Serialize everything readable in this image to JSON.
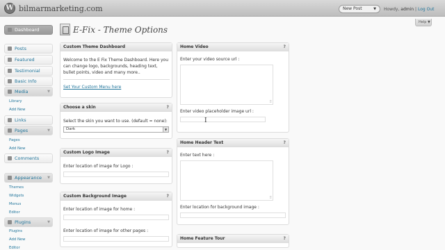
{
  "header": {
    "site_name": "bilmarmarketing.com",
    "new_post": "New Post",
    "howdy": "Howdy,",
    "user": "admin",
    "separator": "|",
    "logout": "Log Out",
    "help": "Help",
    "wp_logo_letter": "W"
  },
  "sidebar": {
    "dashboard": "Dashboard",
    "posts": "Posts",
    "featured": "Featured",
    "testimonial": "Testimonial",
    "basic_info": "Basic Info",
    "media": "Media",
    "media_library": "Library",
    "media_add_new": "Add New",
    "links": "Links",
    "pages": "Pages",
    "pages_pages": "Pages",
    "pages_add_new": "Add New",
    "comments": "Comments",
    "appearance": "Appearance",
    "themes": "Themes",
    "widgets": "Widgets",
    "menus": "Menus",
    "editor": "Editor",
    "plugins": "Plugins",
    "plugins_plugins": "Plugins",
    "plugins_add_new": "Add New",
    "plugins_editor": "Editor"
  },
  "page": {
    "title": "E-Fix - Theme Options"
  },
  "boxes": {
    "dashboard": {
      "title": "Custom Theme Dashboard",
      "body": "Welcome to the E Fix Theme Dashboard. Here you can change logo, backgrounds, heading text, bullet points, video and many more..",
      "link": "Set Your Custom Menu here"
    },
    "skin": {
      "title": "Choose a skin",
      "help": "?",
      "label": "Select the skin you want to use. (default = none):",
      "value": "Dark"
    },
    "logo": {
      "title": "Custom Logo Image",
      "help": "?",
      "label": "Enter location of image for Logo :"
    },
    "background": {
      "title": "Custom Background Image",
      "help": "?",
      "label_home": "Enter location of image for home :",
      "label_other": "Enter location of image for other pages :"
    },
    "video": {
      "title": "Home Video",
      "help": "?",
      "label_source": "Enter your video source url :",
      "label_placeholder": "Enter video placeholder image url :"
    },
    "header_text": {
      "title": "Home Header Text",
      "help": "?",
      "label_text": "Enter text here :",
      "label_bg": "Enter location for background image :"
    },
    "feature_tour": {
      "title": "Home Feature Tour",
      "help": "?"
    }
  },
  "icons": {
    "dropdown": "▼",
    "toggle": "▼",
    "grip": "⠿",
    "cursor": "I"
  }
}
